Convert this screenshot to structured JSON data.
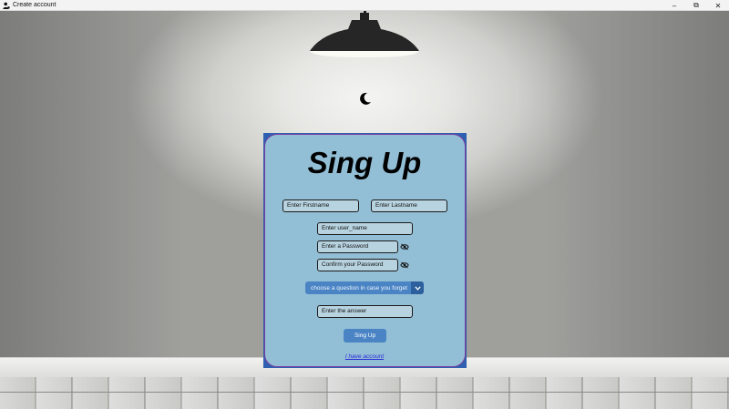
{
  "window": {
    "title": "Create account",
    "icon": "user-icon",
    "controls": {
      "minimize": "–",
      "restore": "⧉",
      "close": "✕"
    }
  },
  "theme_toggle": {
    "icon": "moon-icon"
  },
  "form": {
    "title": "Sing Up",
    "firstname_placeholder": "Enter Firstname",
    "lastname_placeholder": "Enter Lastname",
    "username_placeholder": "Enter user_name",
    "password_placeholder": "Enter a Password",
    "confirm_password_placeholder": "Confirm your Password",
    "security_question": "choose a question in case you forget",
    "answer_placeholder": "Enter the answer",
    "submit_label": "Sing Up",
    "account_link": "I have account"
  },
  "colors": {
    "card_background": "#93bfd6",
    "button": "#4a84c4",
    "link": "#2a2ad8"
  }
}
